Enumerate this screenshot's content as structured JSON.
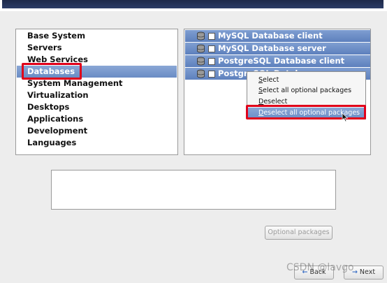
{
  "categories": {
    "items": [
      {
        "label": "Base System"
      },
      {
        "label": "Servers"
      },
      {
        "label": "Web Services"
      },
      {
        "label": "Databases"
      },
      {
        "label": "System Management"
      },
      {
        "label": "Virtualization"
      },
      {
        "label": "Desktops"
      },
      {
        "label": "Applications"
      },
      {
        "label": "Development"
      },
      {
        "label": "Languages"
      }
    ],
    "selected": "Databases"
  },
  "packages": {
    "items": [
      {
        "label": "MySQL Database client",
        "checked": false,
        "icon": "database-icon"
      },
      {
        "label": "MySQL Database server",
        "checked": false,
        "icon": "database-icon"
      },
      {
        "label": "PostgreSQL Database client",
        "checked": false,
        "icon": "database-icon"
      },
      {
        "label": "PostgreSQL Database server",
        "checked": false,
        "icon": "database-icon"
      }
    ]
  },
  "context_menu": {
    "items": [
      {
        "label": "elect",
        "mnemonic": "S"
      },
      {
        "label": "elect all optional packages",
        "mnemonic": "S"
      },
      {
        "label": "eselect",
        "mnemonic": "D"
      },
      {
        "label": "eselect all optional packages",
        "mnemonic": "D"
      }
    ],
    "highlighted": "Deselect all optional packages"
  },
  "buttons": {
    "optional": "Optional packages",
    "back": "Back",
    "next": "Next"
  },
  "watermark": "CSDN @lavgo",
  "colors": {
    "selection": "#6a8cc4",
    "highlight_box": "#e0001a"
  }
}
